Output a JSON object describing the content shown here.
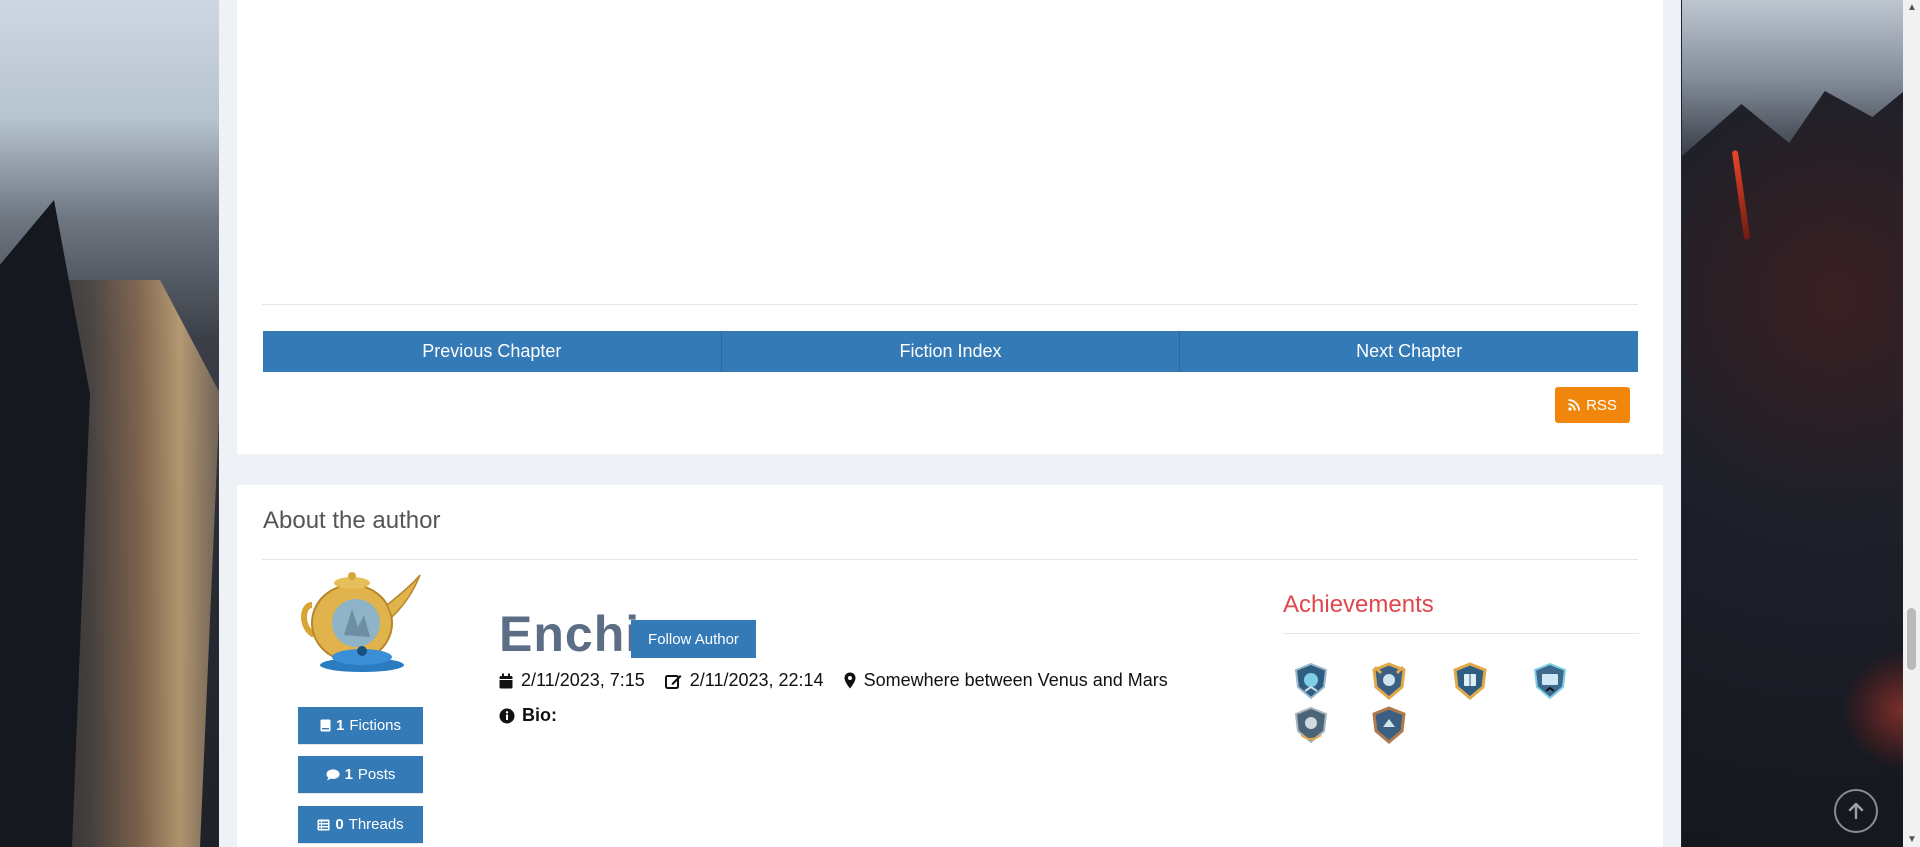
{
  "navigation": {
    "previous_label": "Previous Chapter",
    "index_label": "Fiction Index",
    "next_label": "Next Chapter"
  },
  "rss": {
    "label": "RSS",
    "icon": "rss-icon",
    "color": "#f0870c"
  },
  "about": {
    "title": "About the author",
    "author_name": "Enchi",
    "follow_label": "Follow Author",
    "joined": "2/11/2023, 7:15",
    "last_active": "2/11/2023, 22:14",
    "location": "Somewhere between Venus and Mars",
    "bio_label": "Bio:",
    "stats": [
      {
        "count": "1",
        "label": "Fictions",
        "icon": "book-icon"
      },
      {
        "count": "1",
        "label": "Posts",
        "icon": "comment-icon"
      },
      {
        "count": "0",
        "label": "Threads",
        "icon": "list-icon"
      }
    ]
  },
  "achievements": {
    "title": "Achievements",
    "badges": [
      {
        "icon": "badge-silver-shield-icon"
      },
      {
        "icon": "badge-gold-shield-icon"
      },
      {
        "icon": "badge-gold-book-icon"
      },
      {
        "icon": "badge-silver-screen-icon"
      },
      {
        "icon": "badge-steel-shield-icon"
      },
      {
        "icon": "badge-bronze-shield-icon"
      }
    ]
  },
  "colors": {
    "primary": "#337ab7",
    "rss": "#f0870c",
    "achievements_title": "#e0474c",
    "author_name": "#5b6e85"
  }
}
